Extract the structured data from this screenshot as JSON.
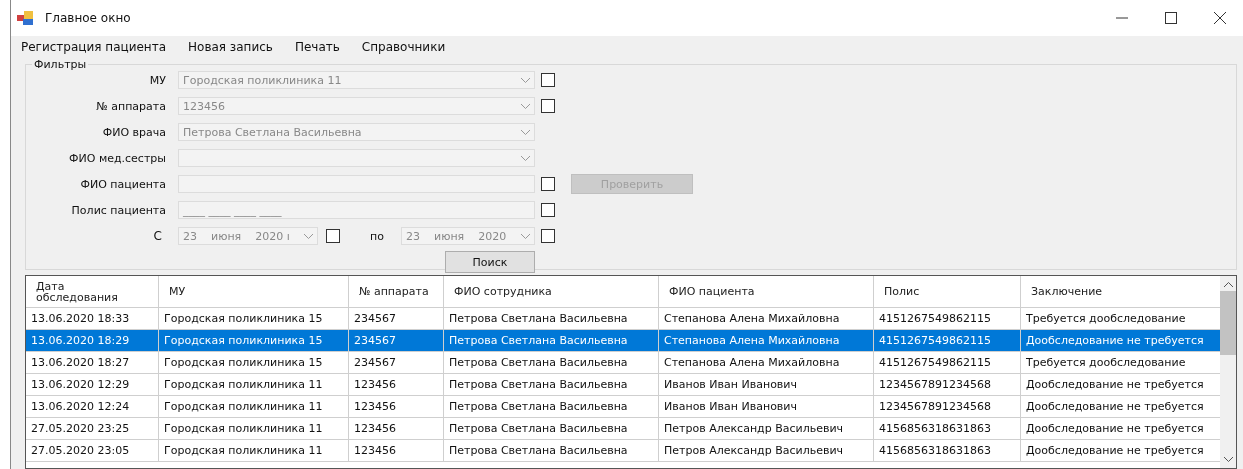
{
  "window": {
    "title": "Главное окно"
  },
  "menu": [
    "Регистрация пациента",
    "Новая запись",
    "Печать",
    "Справочники"
  ],
  "filters": {
    "title": "Фильтры",
    "rows": [
      {
        "kind": "combo",
        "label": "МУ",
        "value": "Городская поликлиника 11",
        "checked": false
      },
      {
        "kind": "combo",
        "label": "№ аппарата",
        "value": "123456",
        "checked": false
      },
      {
        "kind": "combo",
        "label": "ФИО врача",
        "value": "Петрова Светлана Васильевна"
      },
      {
        "kind": "combo",
        "label": "ФИО мед.сестры"
      },
      {
        "kind": "text",
        "label": "ФИО пациента",
        "checked": false,
        "button": {
          "label": "Проверить",
          "disabled": true
        }
      },
      {
        "kind": "mask",
        "label": "Полис пациента",
        "value": "____ ____ ____ ____",
        "checked": false
      }
    ],
    "dates": {
      "from_label": "С",
      "from": {
        "day": "23",
        "month": "июня",
        "year": "2020 ı"
      },
      "from_checked": false,
      "to_label": "по",
      "to": {
        "day": "23",
        "month": "июня",
        "year": "2020"
      },
      "to_checked": false
    },
    "search_button": "Поиск"
  },
  "table": {
    "columns": [
      "Дата обследования",
      "МУ",
      "№ аппарата",
      "ФИО сотрудника",
      "ФИО пациента",
      "Полис",
      "Заключение"
    ],
    "rows": [
      {
        "selected": false,
        "cells": [
          "13.06.2020 18:33",
          "Городская поликлиника 15",
          "234567",
          "Петрова Светлана Васильевна",
          "Степанова Алена Михайловна",
          "4151267549862115",
          "Требуется дообследование"
        ]
      },
      {
        "selected": true,
        "cells": [
          "13.06.2020 18:29",
          "Городская поликлиника 15",
          "234567",
          "Петрова Светлана Васильевна",
          "Степанова Алена Михайловна",
          "4151267549862115",
          "Дообследование не требуется"
        ]
      },
      {
        "selected": false,
        "cells": [
          "13.06.2020 18:27",
          "Городская поликлиника 15",
          "234567",
          "Петрова Светлана Васильевна",
          "Степанова Алена Михайловна",
          "4151267549862115",
          "Требуется дообследование"
        ]
      },
      {
        "selected": false,
        "cells": [
          "13.06.2020 12:29",
          "Городская поликлиника 11",
          "123456",
          "Петрова Светлана Васильевна",
          "Иванов Иван Иванович",
          "1234567891234568",
          "Дообследование не требуется"
        ]
      },
      {
        "selected": false,
        "cells": [
          "13.06.2020 12:24",
          "Городская поликлиника 11",
          "123456",
          "Петрова Светлана Васильевна",
          "Иванов Иван Иванович",
          "1234567891234568",
          "Дообследование не требуется"
        ]
      },
      {
        "selected": false,
        "cells": [
          "27.05.2020 23:25",
          "Городская поликлиника 11",
          "123456",
          "Петрова Светлана Васильевна",
          "Петров Александр Васильевич",
          "4156856318631863",
          "Дообследование не требуется"
        ]
      },
      {
        "selected": false,
        "cells": [
          "27.05.2020 23:05",
          "Городская поликлиника 11",
          "123456",
          "Петрова Светлана Васильевна",
          "Петров Александр Васильевич",
          "4156856318631863",
          "Дообследование не требуется"
        ]
      }
    ]
  }
}
